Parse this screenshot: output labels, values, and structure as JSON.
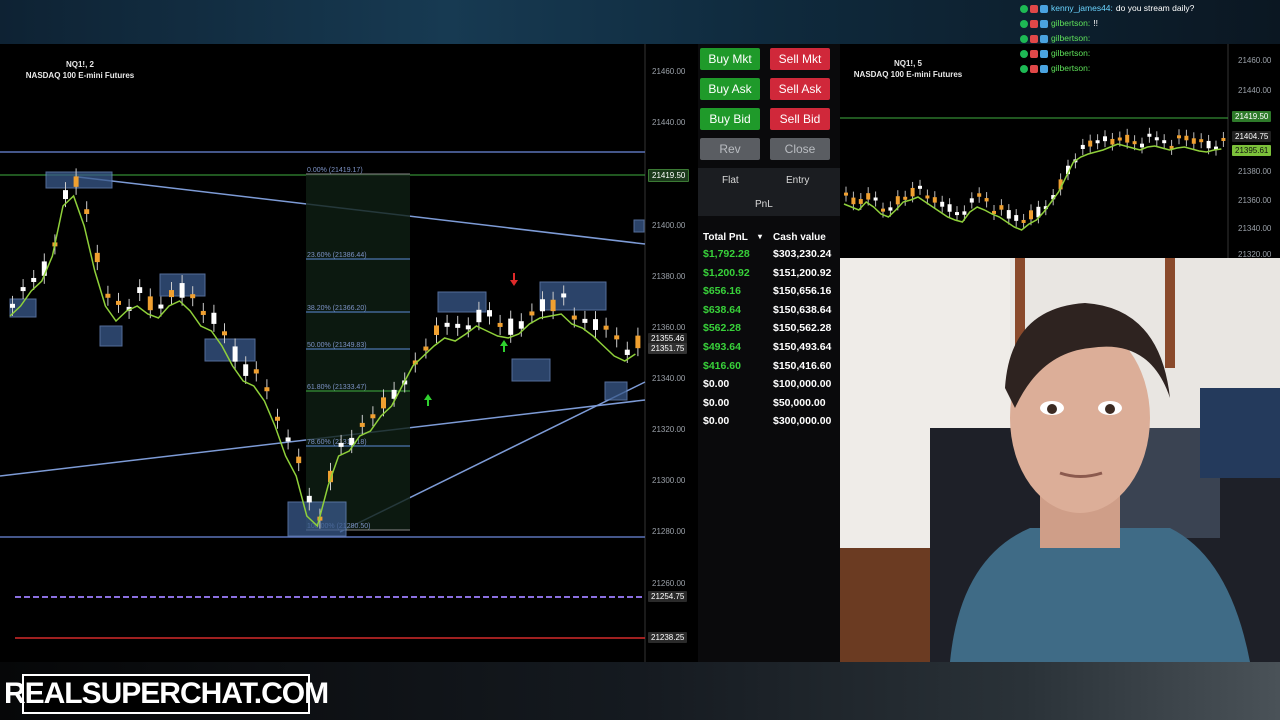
{
  "main_chart": {
    "symbol": "NQ1!, 2",
    "name": "NASDAQ 100 E-mini Futures",
    "y_labels": [
      "21460.00",
      "21440.00",
      "21400.00",
      "21380.00",
      "21360.00",
      "21340.00",
      "21320.00",
      "21300.00",
      "21280.00",
      "21260.00"
    ],
    "tags": {
      "green": "21419.50",
      "price": "21351.75",
      "price2": "21355.46",
      "purple": "21254.75",
      "red": "21238.25"
    },
    "fib_labels": [
      "0.00% (21419.17)",
      "23.60% (21386.44)",
      "38.20% (21366.20)",
      "50.00% (21349.83)",
      "61.80% (21333.47)",
      "78.60% (21310.18)",
      "100.00% (21280.50)"
    ]
  },
  "panel": {
    "buttons": {
      "buy_mkt": "Buy Mkt",
      "sell_mkt": "Sell Mkt",
      "buy_ask": "Buy Ask",
      "sell_ask": "Sell Ask",
      "buy_bid": "Buy Bid",
      "sell_bid": "Sell Bid",
      "rev": "Rev",
      "close": "Close"
    },
    "tabs": {
      "flat": "Flat",
      "entry": "Entry",
      "pnl": "PnL"
    },
    "headers": {
      "total_pnl": "Total PnL",
      "cash_value": "Cash value"
    },
    "rows": [
      {
        "pnl": "$1,792.28",
        "cash": "$303,230.24"
      },
      {
        "pnl": "$1,200.92",
        "cash": "$151,200.92"
      },
      {
        "pnl": "$656.16",
        "cash": "$150,656.16"
      },
      {
        "pnl": "$638.64",
        "cash": "$150,638.64"
      },
      {
        "pnl": "$562.28",
        "cash": "$150,562.28"
      },
      {
        "pnl": "$493.64",
        "cash": "$150,493.64"
      },
      {
        "pnl": "$416.60",
        "cash": "$150,416.60"
      },
      {
        "pnl": "$0.00",
        "cash": "$100,000.00"
      },
      {
        "pnl": "$0.00",
        "cash": "$50,000.00"
      },
      {
        "pnl": "$0.00",
        "cash": "$300,000.00"
      }
    ]
  },
  "right_chart": {
    "symbol": "NQ1!, 5",
    "name": "NASDAQ 100 E-mini Futures",
    "y_labels": [
      "21460.00",
      "21440.00",
      "21380.00",
      "21360.00",
      "21340.00",
      "21320.00"
    ],
    "tags": {
      "green": "21419.50",
      "price": "21404.75",
      "ma": "21395.61"
    }
  },
  "chat": [
    {
      "user": "kenny_james44:",
      "msg": "do you stream daily?"
    },
    {
      "user": "gilbertson:",
      "msg": "!!"
    },
    {
      "user": "gilbertson:",
      "msg": ""
    },
    {
      "user": "gilbertson:",
      "msg": ""
    },
    {
      "user": "gilbertson:",
      "msg": ""
    }
  ],
  "logo": "REALSUPERCHAT.COM",
  "colors": {
    "buy": "#1f9a2a",
    "sell": "#d0283a",
    "pnl_green": "#38d13a",
    "ma_line": "#8fd03a",
    "trendline": "#7d9bd6",
    "bull_candle": "#f0a030",
    "bear_candle": "#ffffff"
  }
}
